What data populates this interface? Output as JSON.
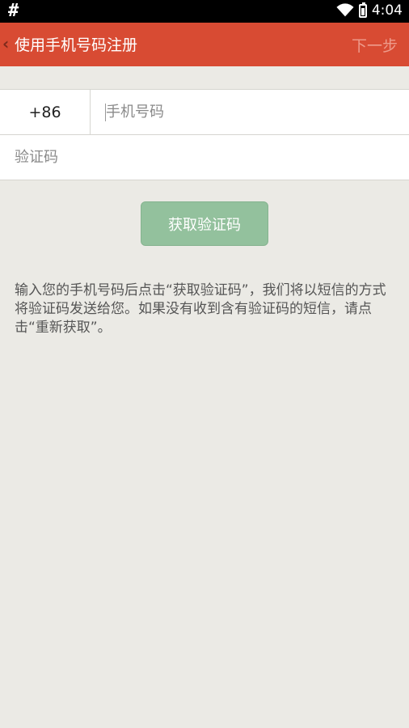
{
  "status_bar": {
    "left_symbol": "#",
    "time": "4:04",
    "icons": [
      "wifi-icon",
      "battery-icon"
    ]
  },
  "app_bar": {
    "back_icon": "‹",
    "title": "使用手机号码注册",
    "next_label": "下一步",
    "background_color": "#d84b33"
  },
  "form": {
    "country_code": "+86",
    "phone_placeholder": "手机号码",
    "phone_value": "",
    "verify_placeholder": "验证码",
    "verify_value": ""
  },
  "get_code_button": {
    "label": "获取验证码",
    "color": "#93c19d"
  },
  "hint_text": "输入您的手机号码后点击“获取验证码”，我们将以短信的方式将验证码发送给您。如果没有收到含有验证码的短信，请点击“重新获取”。"
}
